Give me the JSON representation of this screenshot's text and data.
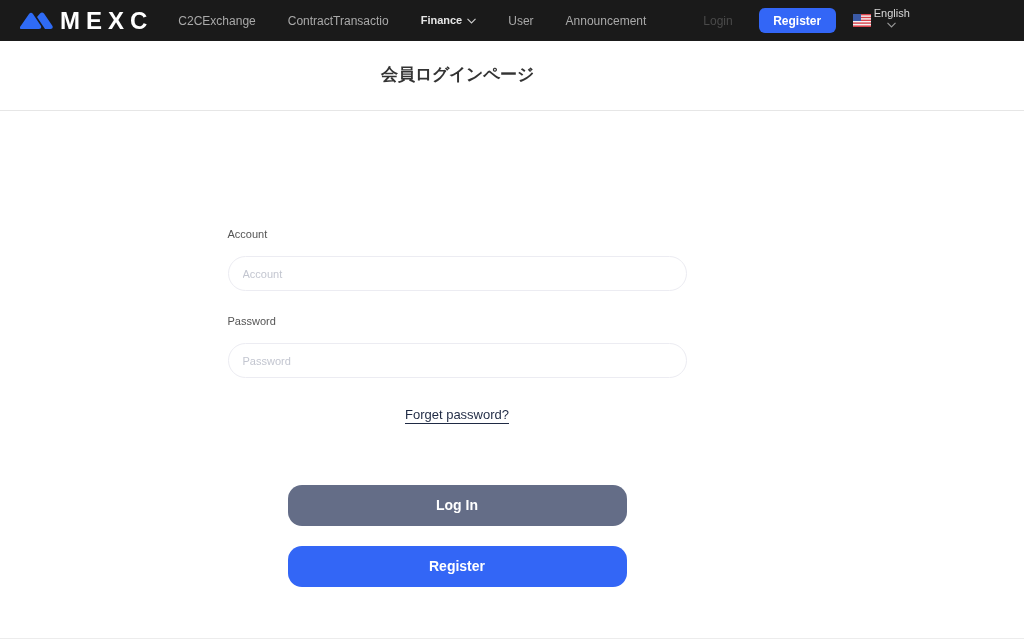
{
  "navbar": {
    "logo": "MEXC",
    "links": [
      {
        "label": "C2CExchange",
        "selected": false,
        "dropdown": false
      },
      {
        "label": "ContractTransactio",
        "selected": false,
        "dropdown": false
      },
      {
        "label": "Finance",
        "selected": true,
        "dropdown": true
      },
      {
        "label": "User",
        "selected": false,
        "dropdown": false
      },
      {
        "label": "Announcement",
        "selected": false,
        "dropdown": false
      }
    ],
    "login": "Login",
    "register": "Register",
    "language": "English"
  },
  "page_title": "会員ログインページ",
  "form": {
    "fields": [
      {
        "label": "Account",
        "placeholder": "Account"
      },
      {
        "label": "Password",
        "placeholder": "Password"
      }
    ],
    "forgot_link": "Forget password?",
    "buttons": [
      {
        "label": "Log In",
        "kind": "secondary"
      },
      {
        "label": "Register",
        "kind": "primary"
      }
    ]
  }
}
